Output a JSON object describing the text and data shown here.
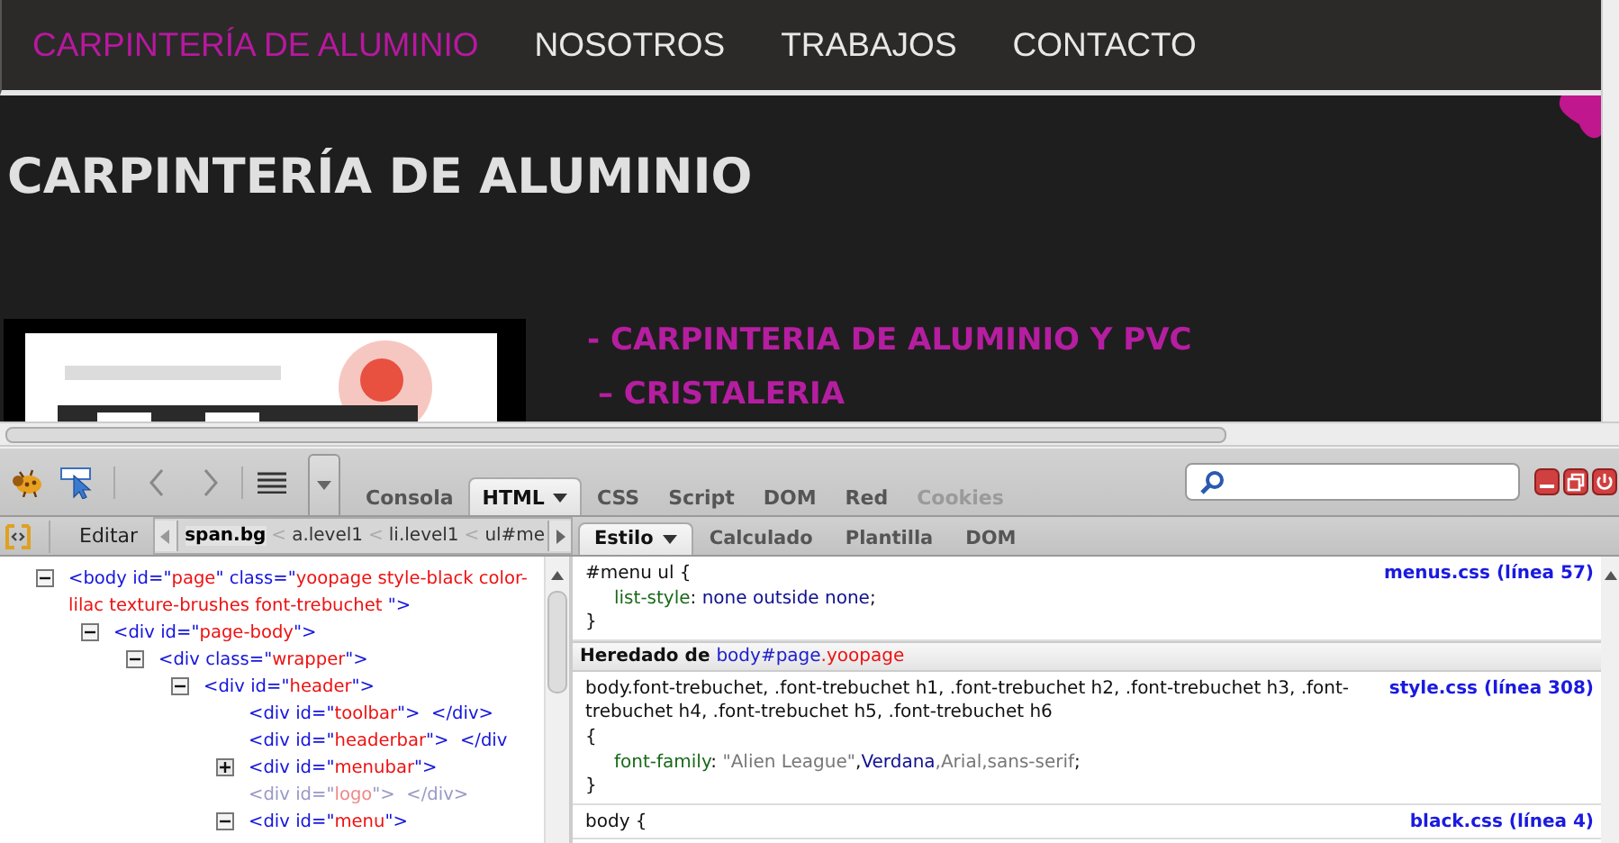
{
  "site": {
    "nav": [
      {
        "label": "CARPINTERÍA DE ALUMINIO",
        "selected": true
      },
      {
        "label": "NOSOTROS",
        "selected": false
      },
      {
        "label": "TRABAJOS",
        "selected": false
      },
      {
        "label": "CONTACTO",
        "selected": false
      }
    ],
    "heading": "CARPINTERÍA DE ALUMINIO",
    "menu_items": [
      "- CARPINTERIA DE ALUMINIO Y PVC",
      "– CRISTALERIA"
    ]
  },
  "firebug": {
    "tabs": [
      {
        "label": "Consola",
        "selected": false,
        "disabled": false,
        "has_menu": false
      },
      {
        "label": "HTML",
        "selected": true,
        "disabled": false,
        "has_menu": true
      },
      {
        "label": "CSS",
        "selected": false,
        "disabled": false,
        "has_menu": false
      },
      {
        "label": "Script",
        "selected": false,
        "disabled": false,
        "has_menu": false
      },
      {
        "label": "DOM",
        "selected": false,
        "disabled": false,
        "has_menu": false
      },
      {
        "label": "Red",
        "selected": false,
        "disabled": false,
        "has_menu": false
      },
      {
        "label": "Cookies",
        "selected": false,
        "disabled": true,
        "has_menu": false
      }
    ],
    "edit_button": "Editar",
    "breadcrumbs": [
      {
        "kind": "crumb",
        "label": "span.bg",
        "selected": true
      },
      {
        "kind": "separator",
        "label": "<"
      },
      {
        "kind": "crumb",
        "label": "a.level1",
        "selected": false
      },
      {
        "kind": "separator",
        "label": "<"
      },
      {
        "kind": "crumb",
        "label": "li.level1",
        "selected": false
      },
      {
        "kind": "separator",
        "label": "<"
      },
      {
        "kind": "crumb",
        "label": "ul#me",
        "selected": false
      }
    ],
    "side_tabs": [
      {
        "label": "Estilo",
        "selected": true,
        "has_menu": true
      },
      {
        "label": "Calculado",
        "selected": false,
        "has_menu": false
      },
      {
        "label": "Plantilla",
        "selected": false,
        "has_menu": false
      },
      {
        "label": "DOM",
        "selected": false,
        "has_menu": false
      }
    ],
    "tree": [
      {
        "kind": "node",
        "expanded": true,
        "dimmed": false,
        "tokens": [
          {
            "kind": "tag",
            "t": "<body"
          },
          {
            "kind": "tag",
            "t": " id=\""
          },
          {
            "kind": "value",
            "t": "page"
          },
          {
            "kind": "tag",
            "t": "\" class=\""
          },
          {
            "kind": "value",
            "t": "yoopage style-black color-lilac texture-brushes font-trebuchet "
          },
          {
            "kind": "tag",
            "t": "\">"
          }
        ],
        "children": [
          {
            "kind": "node",
            "expanded": true,
            "dimmed": false,
            "tokens": [
              {
                "kind": "tag",
                "t": "<div"
              },
              {
                "kind": "tag",
                "t": " id=\""
              },
              {
                "kind": "value",
                "t": "page-body"
              },
              {
                "kind": "tag",
                "t": "\">"
              }
            ],
            "children": [
              {
                "kind": "node",
                "expanded": true,
                "dimmed": false,
                "tokens": [
                  {
                    "kind": "tag",
                    "t": "<div"
                  },
                  {
                    "kind": "tag",
                    "t": " class=\""
                  },
                  {
                    "kind": "value",
                    "t": "wrapper"
                  },
                  {
                    "kind": "tag",
                    "t": "\">"
                  }
                ],
                "children": [
                  {
                    "kind": "node",
                    "expanded": true,
                    "dimmed": false,
                    "tokens": [
                      {
                        "kind": "tag",
                        "t": "<div"
                      },
                      {
                        "kind": "tag",
                        "t": " id=\""
                      },
                      {
                        "kind": "value",
                        "t": "header"
                      },
                      {
                        "kind": "tag",
                        "t": "\">"
                      }
                    ],
                    "children": [
                      {
                        "kind": "leaf",
                        "dimmed": false,
                        "tokens": [
                          {
                            "kind": "tag",
                            "t": "<div"
                          },
                          {
                            "kind": "tag",
                            "t": " id=\""
                          },
                          {
                            "kind": "value",
                            "t": "toolbar"
                          },
                          {
                            "kind": "tag",
                            "t": "\">  </div>"
                          }
                        ]
                      },
                      {
                        "kind": "leaf",
                        "dimmed": false,
                        "tokens": [
                          {
                            "kind": "tag",
                            "t": "<div"
                          },
                          {
                            "kind": "tag",
                            "t": " id=\""
                          },
                          {
                            "kind": "value",
                            "t": "headerbar"
                          },
                          {
                            "kind": "tag",
                            "t": "\">  </div"
                          }
                        ]
                      },
                      {
                        "kind": "node",
                        "expanded": false,
                        "dimmed": false,
                        "tokens": [
                          {
                            "kind": "tag",
                            "t": "<div"
                          },
                          {
                            "kind": "tag",
                            "t": " id=\""
                          },
                          {
                            "kind": "value",
                            "t": "menubar"
                          },
                          {
                            "kind": "tag",
                            "t": "\">"
                          }
                        ]
                      },
                      {
                        "kind": "leaf",
                        "dimmed": true,
                        "tokens": [
                          {
                            "kind": "tag",
                            "t": "<div"
                          },
                          {
                            "kind": "tag",
                            "t": " id=\""
                          },
                          {
                            "kind": "value",
                            "t": "logo"
                          },
                          {
                            "kind": "tag",
                            "t": "\">  </div>"
                          }
                        ]
                      },
                      {
                        "kind": "node",
                        "expanded": true,
                        "dimmed": false,
                        "tokens": [
                          {
                            "kind": "tag",
                            "t": "<div"
                          },
                          {
                            "kind": "tag",
                            "t": " id=\""
                          },
                          {
                            "kind": "value",
                            "t": "menu"
                          },
                          {
                            "kind": "tag",
                            "t": "\">"
                          }
                        ]
                      }
                    ]
                  }
                ]
              }
            ]
          }
        ]
      }
    ],
    "style_sections": [
      {
        "kind": "rule",
        "selector_lines": [
          "#menu ul {"
        ],
        "source": "menus.css (línea 57)",
        "declarations": [
          [
            {
              "kind": "property",
              "t": "list-style"
            },
            {
              "kind": "plain",
              "t": ": "
            },
            {
              "kind": "value",
              "t": "none outside none"
            },
            {
              "kind": "plain",
              "t": ";"
            }
          ]
        ],
        "closing": "}"
      },
      {
        "kind": "inherited",
        "tokens": [
          {
            "kind": "label",
            "t": "Heredado de "
          },
          {
            "kind": "element",
            "t": "body"
          },
          {
            "kind": "id",
            "t": "#page"
          },
          {
            "kind": "class",
            "t": ".yoopage"
          }
        ]
      },
      {
        "kind": "rule",
        "selector_lines": [
          "body.font-trebuchet, .font-trebuchet h1, .font-trebuchet h2, .font-trebuchet h3, .font-trebuchet h4, .font-trebuchet h5, .font-trebuchet h6",
          "{"
        ],
        "source": "style.css (línea 308)",
        "declarations": [
          [
            {
              "kind": "property",
              "t": "font-family"
            },
            {
              "kind": "plain",
              "t": ": "
            },
            {
              "kind": "string",
              "t": "\"Alien League\""
            },
            {
              "kind": "plain",
              "t": ","
            },
            {
              "kind": "value",
              "t": "Verdana"
            },
            {
              "kind": "string",
              "t": ",Arial,sans-serif"
            },
            {
              "kind": "plain",
              "t": ";"
            }
          ]
        ],
        "closing": "}"
      },
      {
        "kind": "rule",
        "selector_lines": [
          "body {"
        ],
        "source": "black.css (línea 4)"
      }
    ]
  }
}
